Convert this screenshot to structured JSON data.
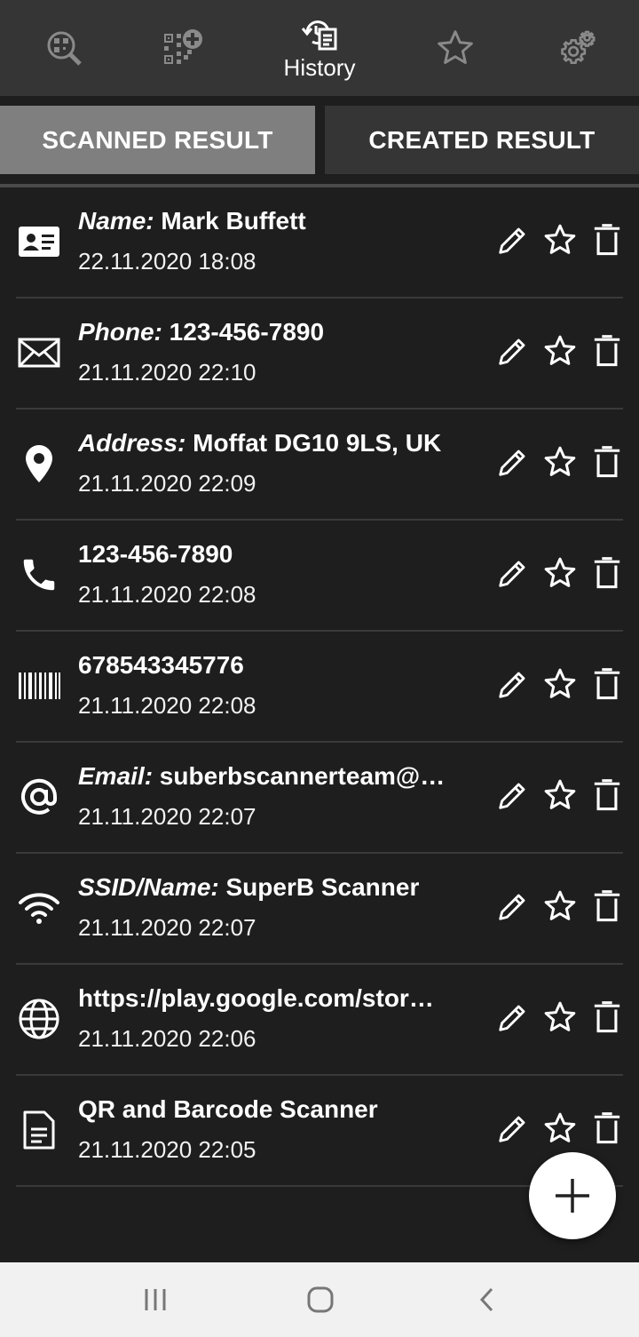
{
  "nav": {
    "items": [
      {
        "icon": "scan-icon",
        "label": ""
      },
      {
        "icon": "qr-create-icon",
        "label": ""
      },
      {
        "icon": "history-icon",
        "label": "History"
      },
      {
        "icon": "star-icon",
        "label": ""
      },
      {
        "icon": "gear-icon",
        "label": ""
      }
    ],
    "active_index": 2
  },
  "tabs": {
    "scanned": "SCANNED RESULT",
    "created": "CREATED RESULT",
    "active": "scanned"
  },
  "history": [
    {
      "icon": "contact-card-icon",
      "label": "Name:",
      "value": " Mark Buffett",
      "date": "22.11.2020 18:08"
    },
    {
      "icon": "envelope-icon",
      "label": "Phone:",
      "value": " 123-456-7890",
      "date": "21.11.2020 22:10"
    },
    {
      "icon": "location-pin-icon",
      "label": "Address:",
      "value": " Moffat DG10 9LS, UK",
      "date": "21.11.2020 22:09"
    },
    {
      "icon": "phone-icon",
      "label": "",
      "value": "123-456-7890",
      "date": "21.11.2020 22:08"
    },
    {
      "icon": "barcode-icon",
      "label": "",
      "value": "678543345776",
      "date": "21.11.2020 22:08"
    },
    {
      "icon": "at-sign-icon",
      "label": "Email:",
      "value": " suberbscannerteam@…",
      "date": "21.11.2020 22:07"
    },
    {
      "icon": "wifi-icon",
      "label": "SSID/Name:",
      "value": " SuperB Scanner",
      "date": "21.11.2020 22:07"
    },
    {
      "icon": "globe-icon",
      "label": "",
      "value": "https://play.google.com/stor…",
      "date": "21.11.2020 22:06"
    },
    {
      "icon": "document-icon",
      "label": "",
      "value": "QR and Barcode Scanner",
      "date": "21.11.2020 22:05"
    }
  ],
  "colors": {
    "topbar": "#353535",
    "background": "#1e1e1e",
    "active_tab": "#7f7f7f",
    "inactive_tab": "#353535",
    "nav_icon_inactive": "#8a8a8a"
  }
}
